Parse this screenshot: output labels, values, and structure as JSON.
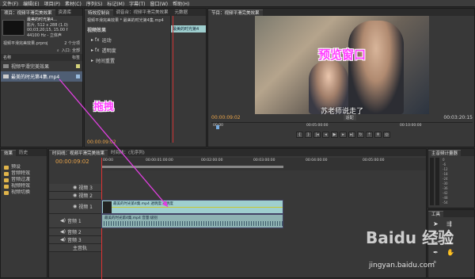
{
  "menu": [
    "文件(F)",
    "编辑(E)",
    "项目(P)",
    "素材(C)",
    "序列(S)",
    "标记(M)",
    "字幕(T)",
    "窗口(W)",
    "帮助(H)"
  ],
  "project_panel": {
    "tabs": [
      "项目：视频平滑完美效果",
      "资源库",
      "信息"
    ],
    "clip_name": "最美的时光第4...",
    "clip_info": [
      "影片, 512 x 288 (1.0)",
      "00;03;20;15, 15.00 f",
      "44100 Hz - 立体声"
    ],
    "project_file": "视频平滑完美效果.prproj",
    "item_count": "2 个分项",
    "in_label": "入口: 全部",
    "col_name": "名称",
    "col_label": "标签",
    "items": [
      "视频平滑完美效果",
      "最美的时光第4集.mp4"
    ]
  },
  "effect_controls": {
    "tabs": [
      "特效控制台",
      "调音台：视频平滑完美效果",
      "元数据"
    ],
    "header": "视频平滑完美效果 * 最美的时光第4集.mp4",
    "section": "视频效果",
    "rows": [
      "运动",
      "透明度",
      "时间重置"
    ],
    "mini_clip": "最美的时光第4",
    "timecode": "00:00:09:02"
  },
  "monitor": {
    "tab": "节目：视频平滑完美效果",
    "subtitle": "苏老师说走了",
    "current_time": "00:00:09:02",
    "fit": "适配",
    "duration": "00:03:20:15",
    "ruler": [
      "00:00",
      "00:05:00:00",
      "00:10:00:00"
    ]
  },
  "effects_panel": {
    "tabs": [
      "效果",
      "历史"
    ],
    "items": [
      "预设",
      "音频特效",
      "音频过渡",
      "视频特效",
      "视频切换"
    ]
  },
  "timeline": {
    "tabs": [
      "时间线：视频平滑完美效果",
      "时间线：(无序列)"
    ],
    "timecode": "00:00:09:02",
    "ruler": [
      "00:00",
      "00:00:01:00:00",
      "00:02:00:00",
      "00:03:00:00",
      "00:04:00:00",
      "00:05:00:00"
    ],
    "tracks": [
      "视频 3",
      "视频 2",
      "视频 1",
      "音频 1",
      "音频 2",
      "音频 3",
      "主音轨"
    ],
    "video_clip": "最美的时光第4集.mp4 透明度:透明度",
    "audio_clip": "最美的时光第4集.mp4 音量:级别"
  },
  "audio_meter": {
    "tab": "主音频计量器",
    "scale": [
      "0",
      "-6",
      "-12",
      "-18",
      "-24",
      "-30",
      "-36",
      "-42",
      "-48",
      "-54"
    ]
  },
  "tools": {
    "tab": "工具"
  },
  "annotations": {
    "preview": "预览窗口",
    "drag": "拖拽"
  },
  "watermark": "Baidu 经验",
  "watermark_url": "jingyan.baidu.com"
}
